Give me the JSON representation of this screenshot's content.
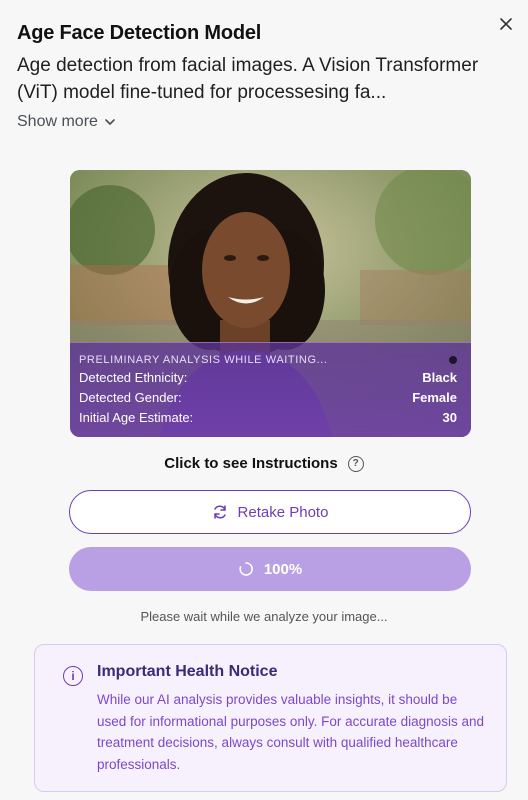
{
  "header": {
    "title": "Age Face Detection Model",
    "description": "Age detection from facial images. A Vision Transformer (ViT) model fine-tuned for processesing fa...",
    "show_more": "Show more"
  },
  "analysis": {
    "heading": "PRELIMINARY ANALYSIS WHILE WAITING...",
    "rows": [
      {
        "label": "Detected Ethnicity:",
        "value": "Black"
      },
      {
        "label": "Detected Gender:",
        "value": "Female"
      },
      {
        "label": "Initial Age Estimate:",
        "value": "30"
      }
    ]
  },
  "instructions": {
    "label": "Click to see Instructions"
  },
  "buttons": {
    "retake": "Retake Photo",
    "progress": "100%",
    "progress_value": 1.0
  },
  "status": {
    "wait": "Please wait while we analyze your image..."
  },
  "notice": {
    "title": "Important Health Notice",
    "body": "While our AI analysis provides valuable insights, it should be used for informational purposes only. For accurate diagnosis and treatment decisions, always consult with qualified healthcare professionals."
  },
  "colors": {
    "accent": "#6b3fb5",
    "progress_fill": "#b9a0e4",
    "notice_bg": "#f6f1fd"
  },
  "icons": [
    "close-icon",
    "chevron-down-icon",
    "help-icon",
    "refresh-icon",
    "spinner-icon",
    "info-icon"
  ]
}
